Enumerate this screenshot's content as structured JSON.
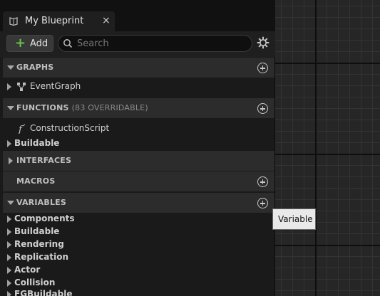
{
  "tab": {
    "title": "My Blueprint",
    "close_glyph": "×",
    "icon": "document-icon"
  },
  "toolbar": {
    "add_label": "Add",
    "search_placeholder": "Search",
    "settings_icon": "gear-icon"
  },
  "sections": {
    "graphs": {
      "title": "GRAPHS"
    },
    "functions": {
      "title": "FUNCTIONS",
      "subtitle": "(83 OVERRIDABLE)"
    },
    "interfaces": {
      "title": "INTERFACES"
    },
    "macros": {
      "title": "MACROS"
    },
    "variables": {
      "title": "VARIABLES"
    }
  },
  "graphs_items": [
    "EventGraph"
  ],
  "functions_items": [
    "ConstructionScript",
    "Buildable"
  ],
  "variables_items": [
    "Components",
    "Buildable",
    "Rendering",
    "Replication",
    "Actor",
    "Collision",
    "FGBuildable"
  ],
  "tooltip": {
    "text": "Variable"
  },
  "colors": {
    "panel_bg": "#1a1a1a",
    "section_bg": "#2c2c2c",
    "add_plus": "#66c24a",
    "tooltip_bg": "#e9e9e9"
  }
}
